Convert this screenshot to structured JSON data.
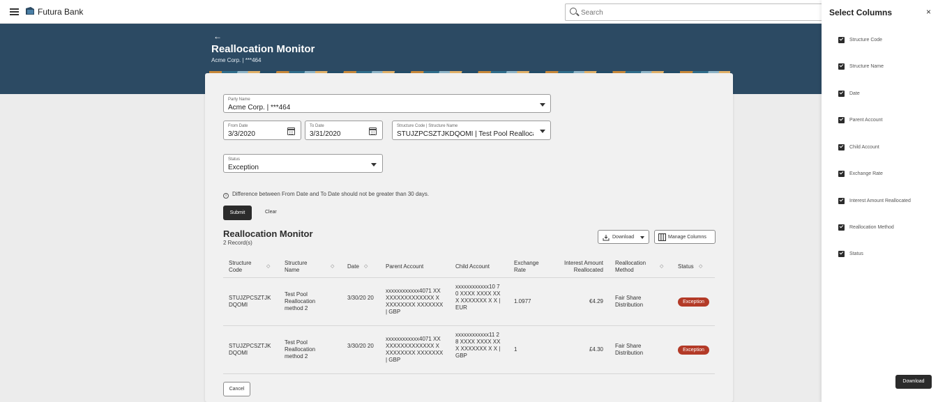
{
  "app": {
    "brand": "Futura Bank"
  },
  "search": {
    "placeholder": "Search"
  },
  "header": {
    "title": "Reallocation Monitor",
    "subtitle": "Acme Corp. | ***464",
    "back": "←"
  },
  "form": {
    "party": {
      "label": "Party Name",
      "value": "Acme Corp. | ***464"
    },
    "from_date": {
      "label": "From Date",
      "value": "3/3/2020"
    },
    "to_date": {
      "label": "To Date",
      "value": "3/31/2020"
    },
    "structure": {
      "label": "Structure Code | Structure Name",
      "value": "STUJZPCSZTJKDQOMI | Test Pool Reallocation ..."
    },
    "status": {
      "label": "Status",
      "value": "Exception"
    },
    "info": "Difference between From Date and To Date should not be greater than 30 days.",
    "info_icon": "i",
    "submit": "Submit",
    "clear": "Clear"
  },
  "results": {
    "title": "Reallocation Monitor",
    "records": "2 Record(s)",
    "download": "Download",
    "manage": "Manage Columns",
    "columns": {
      "structure_code": "Structure Code",
      "structure_name": "Structure Name",
      "date": "Date",
      "parent": "Parent Account",
      "child": "Child Account",
      "rate": "Exchange Rate",
      "interest": "Interest Amount Reallocated",
      "method": "Reallocation Method",
      "status": "Status"
    },
    "rows": [
      {
        "structure_code": "STUJZPCSZTJK DQOMI",
        "structure_name": "Test Pool Reallocation method 2",
        "date": "3/30/20 20",
        "parent": "xxxxxxxxxxxx4071 XXXXXXXXXXXXXXX X XXXXXXXX XXXXXXX | GBP",
        "child": "xxxxxxxxxxxx10 70 XXXX XXXX XXX XXXXXXX X X | EUR",
        "rate": "1.0977",
        "interest": "€4.29",
        "method": "Fair Share Distribution",
        "status": "Exception"
      },
      {
        "structure_code": "STUJZPCSZTJK DQOMI",
        "structure_name": "Test Pool Reallocation method 2",
        "date": "3/30/20 20",
        "parent": "xxxxxxxxxxxx4071 XXXXXXXXXXXXXXX X XXXXXXXX XXXXXXX | GBP",
        "child": "xxxxxxxxxxxx11 28 XXXX XXXX XXX XXXXXXX X X | GBP",
        "rate": "1",
        "interest": "£4.30",
        "method": "Fair Share Distribution",
        "status": "Exception"
      }
    ],
    "cancel": "Cancel"
  },
  "panel": {
    "title": "Select Columns",
    "close": "×",
    "items": [
      {
        "label": "Structure Code",
        "checked": true
      },
      {
        "label": "Structure Name",
        "checked": true
      },
      {
        "label": "Date",
        "checked": true
      },
      {
        "label": "Parent Account",
        "checked": true
      },
      {
        "label": "Child Account",
        "checked": true
      },
      {
        "label": "Exchange Rate",
        "checked": true
      },
      {
        "label": "Interest Amount Reallocated",
        "checked": true
      },
      {
        "label": "Reallocation Method",
        "checked": true
      },
      {
        "label": "Status",
        "checked": true
      }
    ],
    "download": "Download"
  },
  "colors": {
    "banner": "#2c4a63",
    "status_badge": "#b33a27",
    "dark_button": "#2b2b2b"
  },
  "icons": [
    "hamburger-icon",
    "bank-logo-icon",
    "search-icon",
    "back-arrow-icon",
    "caret-down-icon",
    "calendar-icon",
    "info-icon",
    "sort-icon",
    "download-icon",
    "columns-icon",
    "close-icon",
    "checkbox-icon"
  ]
}
